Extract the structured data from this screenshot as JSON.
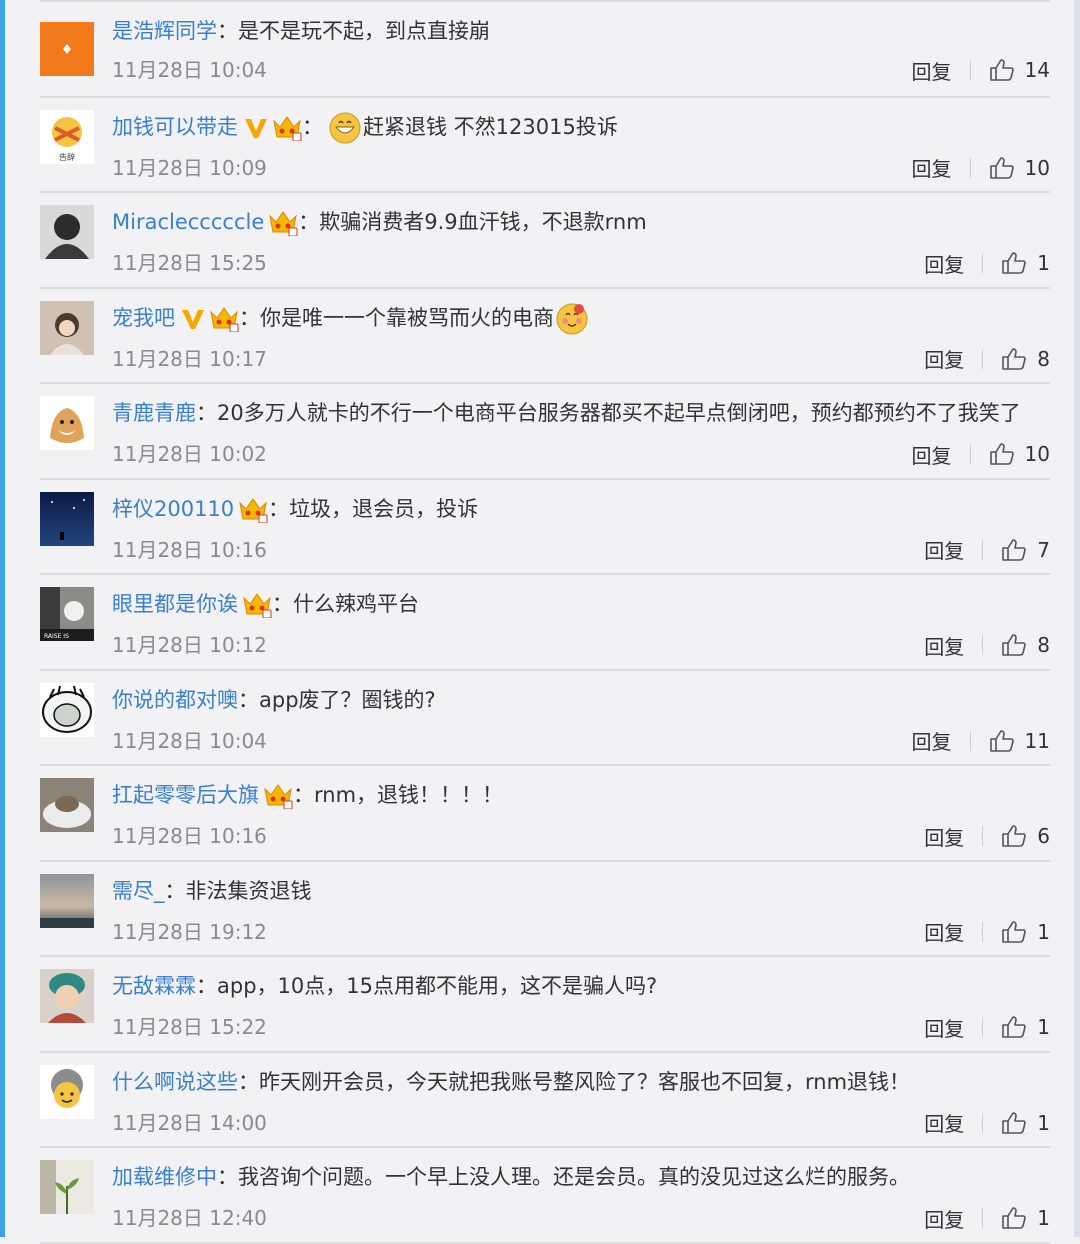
{
  "comments": [
    {
      "user": "是浩辉同学",
      "sep": "：",
      "text": "是不是玩不起，到点直接崩",
      "time": "11月28日 10:04",
      "reply": "回复",
      "likes": "14",
      "vip": false,
      "member": false,
      "avatar": "orange-logo-avatar"
    },
    {
      "user": "加钱可以带走",
      "sep": "：",
      "text": "赶紧退钱 不然123015投诉",
      "time": "11月28日 10:09",
      "reply": "回复",
      "likes": "10",
      "vip": true,
      "member": true,
      "emoji": "grin",
      "avatar": "emoji-avatar"
    },
    {
      "user": "Miraclecccccle",
      "sep": "：",
      "text": "欺骗消费者9.9血汗钱，不退款rnm",
      "time": "11月28日 15:25",
      "reply": "回复",
      "likes": "1",
      "vip": false,
      "member": true,
      "avatar": "person-avatar"
    },
    {
      "user": "宠我吧",
      "sep": "：",
      "text": "你是唯一一个靠被骂而火的电商",
      "time": "11月28日 10:17",
      "reply": "回复",
      "likes": "8",
      "vip": true,
      "member": true,
      "emoji": "yum",
      "avatar": "child-avatar"
    },
    {
      "user": "青鹿青鹿",
      "sep": "：",
      "text": "20多万人就卡的不行一个电商平台服务器都买不起早点倒闭吧，预约都预约不了我笑了",
      "time": "11月28日 10:02",
      "reply": "回复",
      "likes": "10",
      "vip": false,
      "member": false,
      "avatar": "dog-avatar"
    },
    {
      "user": "梓仪200110",
      "sep": "：",
      "text": "垃圾，退会员，投诉",
      "time": "11月28日 10:16",
      "reply": "回复",
      "likes": "7",
      "vip": false,
      "member": true,
      "avatar": "night-sky-avatar"
    },
    {
      "user": "眼里都是你诶",
      "sep": "：",
      "text": "什么辣鸡平台",
      "time": "11月28日 10:12",
      "reply": "回复",
      "likes": "8",
      "vip": false,
      "member": true,
      "avatar": "cat-avatar"
    },
    {
      "user": "你说的都对噢",
      "sep": "：",
      "text": "app废了？圈钱的?",
      "time": "11月28日 10:04",
      "reply": "回复",
      "likes": "11",
      "vip": false,
      "member": false,
      "avatar": "meme-face-avatar"
    },
    {
      "user": "扛起零零后大旗",
      "sep": "：",
      "text": "rnm，退钱！！！！",
      "time": "11月28日 10:16",
      "reply": "回复",
      "likes": "6",
      "vip": false,
      "member": true,
      "avatar": "cat-bed-avatar"
    },
    {
      "user": "需尽_",
      "sep": "：",
      "text": "非法集资退钱",
      "time": "11月28日 19:12",
      "reply": "回复",
      "likes": "1",
      "vip": false,
      "member": false,
      "avatar": "landscape-avatar"
    },
    {
      "user": "无敌霖霖",
      "sep": "：",
      "text": "app，10点，15点用都不能用，这不是骗人吗?",
      "time": "11月28日 15:22",
      "reply": "回复",
      "likes": "1",
      "vip": false,
      "member": false,
      "avatar": "baby-avatar"
    },
    {
      "user": "什么啊说这些",
      "sep": "：",
      "text": "昨天刚开会员，今天就把我账号整风险了？客服也不回复，rnm退钱！",
      "time": "11月28日 14:00",
      "reply": "回复",
      "likes": "1",
      "vip": false,
      "member": false,
      "avatar": "cartoon-avatar"
    },
    {
      "user": "加载维修中",
      "sep": "：",
      "text": "我咨询个问题。一个早上没人理。还是会员。真的没见过这么烂的服务。",
      "time": "11月28日 12:40",
      "reply": "回复",
      "likes": "1",
      "vip": false,
      "member": false,
      "avatar": "plant-avatar"
    }
  ],
  "colors": {
    "username": "#3a7fcf",
    "text": "#333333",
    "time": "#8a8a8a",
    "accent": "#3ea0e8"
  }
}
